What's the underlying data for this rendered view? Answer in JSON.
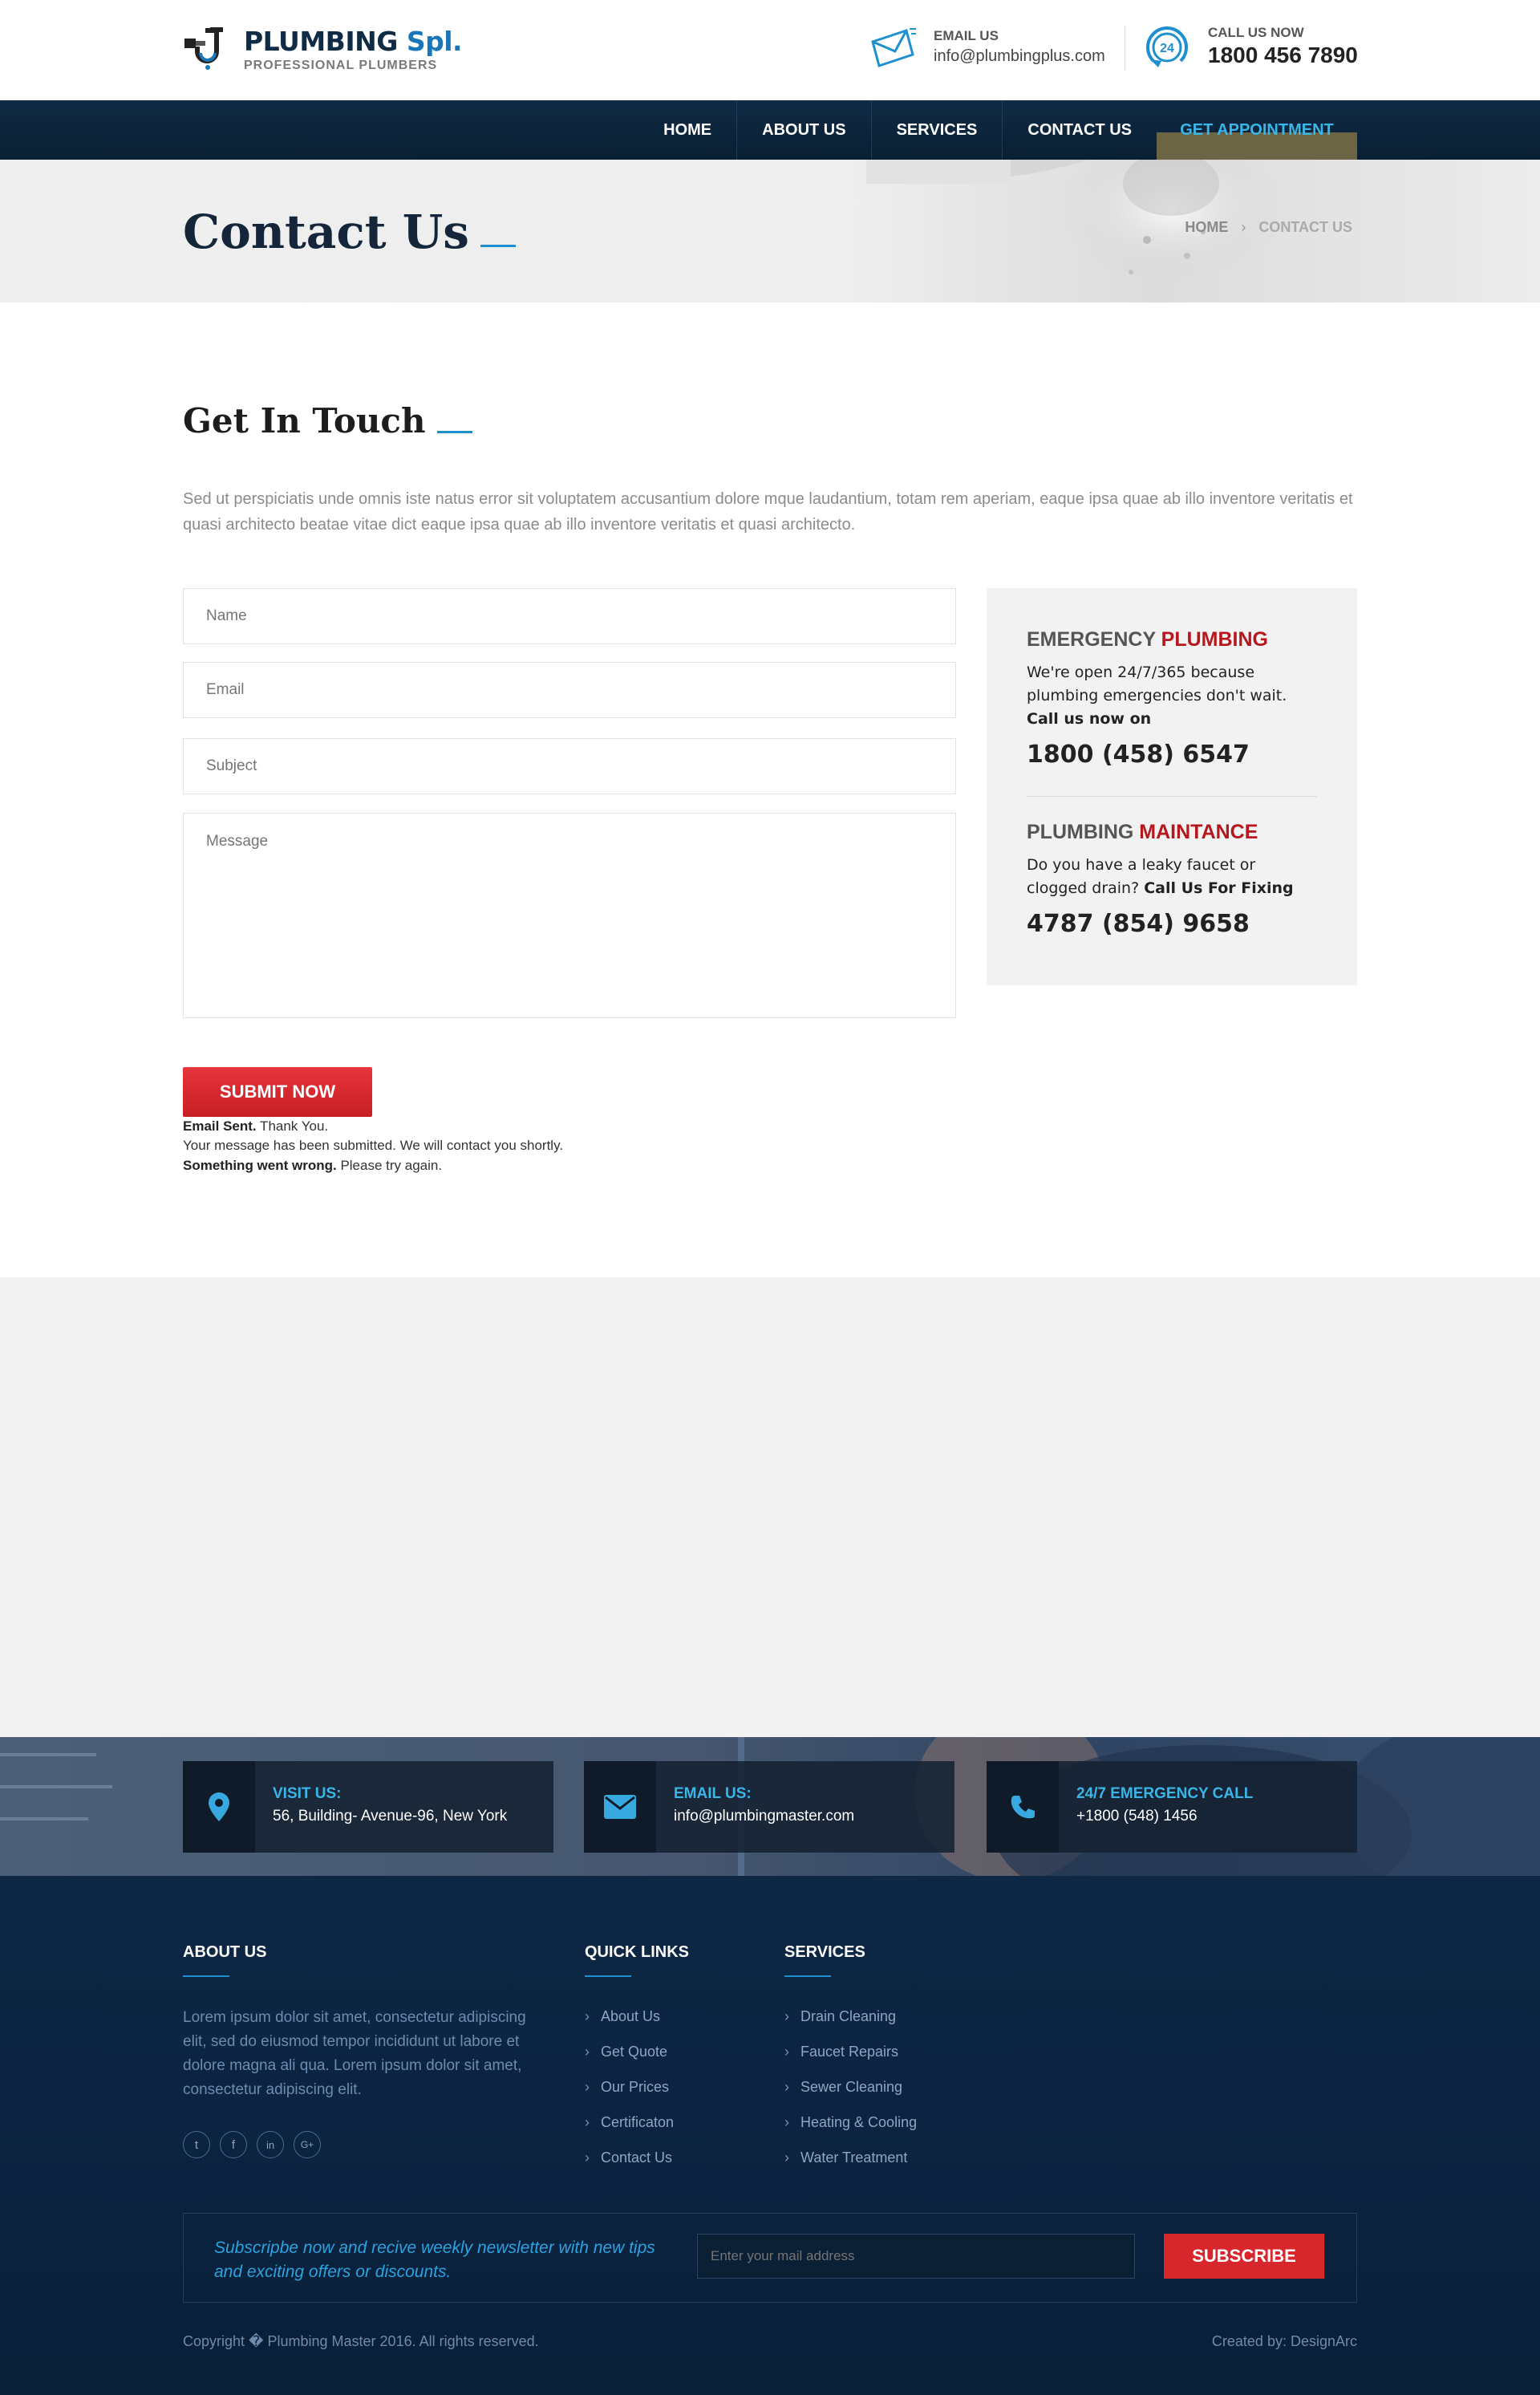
{
  "header": {
    "logo_title": "PLUMBING",
    "logo_title_accent": "Spl.",
    "logo_subtitle": "PROFESSIONAL PLUMBERS",
    "email_label": "EMAIL US",
    "email_value": "info@plumbingplus.com",
    "call_label": "CALL US NOW",
    "call_value": "1800 456 7890",
    "call_icon_text": "24"
  },
  "nav": {
    "items": [
      "HOME",
      "ABOUT US",
      "SERVICES",
      "CONTACT US"
    ],
    "appointment": "GET APPOINTMENT"
  },
  "banner": {
    "title": "Contact Us",
    "breadcrumb_home": "HOME",
    "breadcrumb_sep": "›",
    "breadcrumb_current": "CONTACT US"
  },
  "touch": {
    "title": "Get In Touch",
    "intro": "Sed ut perspiciatis unde omnis iste natus error sit voluptatem accusantium dolore mque laudantium, totam rem aperiam, eaque ipsa quae ab illo inventore veritatis et quasi architecto beatae vitae dict eaque ipsa quae ab illo inventore veritatis et quasi architecto."
  },
  "form": {
    "name_placeholder": "Name",
    "email_placeholder": "Email",
    "subject_placeholder": "Subject",
    "message_placeholder": "Message",
    "submit_label": "SUBMIT NOW",
    "sent_bold": "Email Sent.",
    "sent_rest": " Thank You.",
    "submitted": "Your message has been submitted. We will contact you shortly.",
    "error_bold": "Something went wrong.",
    "error_rest": " Please try again."
  },
  "emergency": {
    "h1_a": "EMERGENCY",
    "h1_b": "PLUMBING",
    "p1": "We're open 24/7/365 because plumbing emergencies don't wait.",
    "p1_bold": "Call us now on",
    "phone1": "1800 (458) 6547",
    "h2_a": "PLUMBING",
    "h2_b": "MAINTANCE",
    "p2": "Do you have a leaky faucet or clogged drain?",
    "p2_bold": "Call Us For Fixing",
    "phone2": "4787 (854) 9658",
    "accent_color": "#b5171d"
  },
  "info_strip": [
    {
      "label": "VISIT US:",
      "value": "56, Building- Avenue-96, New York",
      "icon": "map-pin-icon"
    },
    {
      "label": "EMAIL US:",
      "value": "info@plumbingmaster.com",
      "icon": "envelope-icon"
    },
    {
      "label": "24/7 EMERGENCY CALL",
      "value": "+1800 (548) 1456",
      "icon": "phone-icon"
    }
  ],
  "footer": {
    "about_title": "ABOUT US",
    "about_text": "Lorem ipsum dolor sit amet, consectetur adipiscing elit, sed do eiusmod tempor incididunt ut labore et dolore magna ali qua. Lorem ipsum dolor sit amet, consectetur adipiscing elit.",
    "social": [
      "twitter-icon",
      "facebook-icon",
      "linkedin-icon",
      "google-plus-icon"
    ],
    "social_glyphs": [
      "t",
      "f",
      "in",
      "G+"
    ],
    "quick_title": "QUICK LINKS",
    "quick_links": [
      "About Us",
      "Get Quote",
      "Our Prices",
      "Certificaton",
      "Contact Us"
    ],
    "services_title": "SERVICES",
    "services": [
      "Drain Cleaning",
      "Faucet Repairs",
      "Sewer Cleaning",
      "Heating & Cooling",
      "Water Treatment"
    ],
    "newsletter_text": "Subscripbe now and recive weekly newsletter with new tips and exciting offers or discounts.",
    "newsletter_placeholder": "Enter your mail address",
    "subscribe_label": "SUBSCRIBE",
    "copyright": "Copyright � Plumbing Master 2016. All rights reserved.",
    "credit": "Created by: DesignArc"
  }
}
